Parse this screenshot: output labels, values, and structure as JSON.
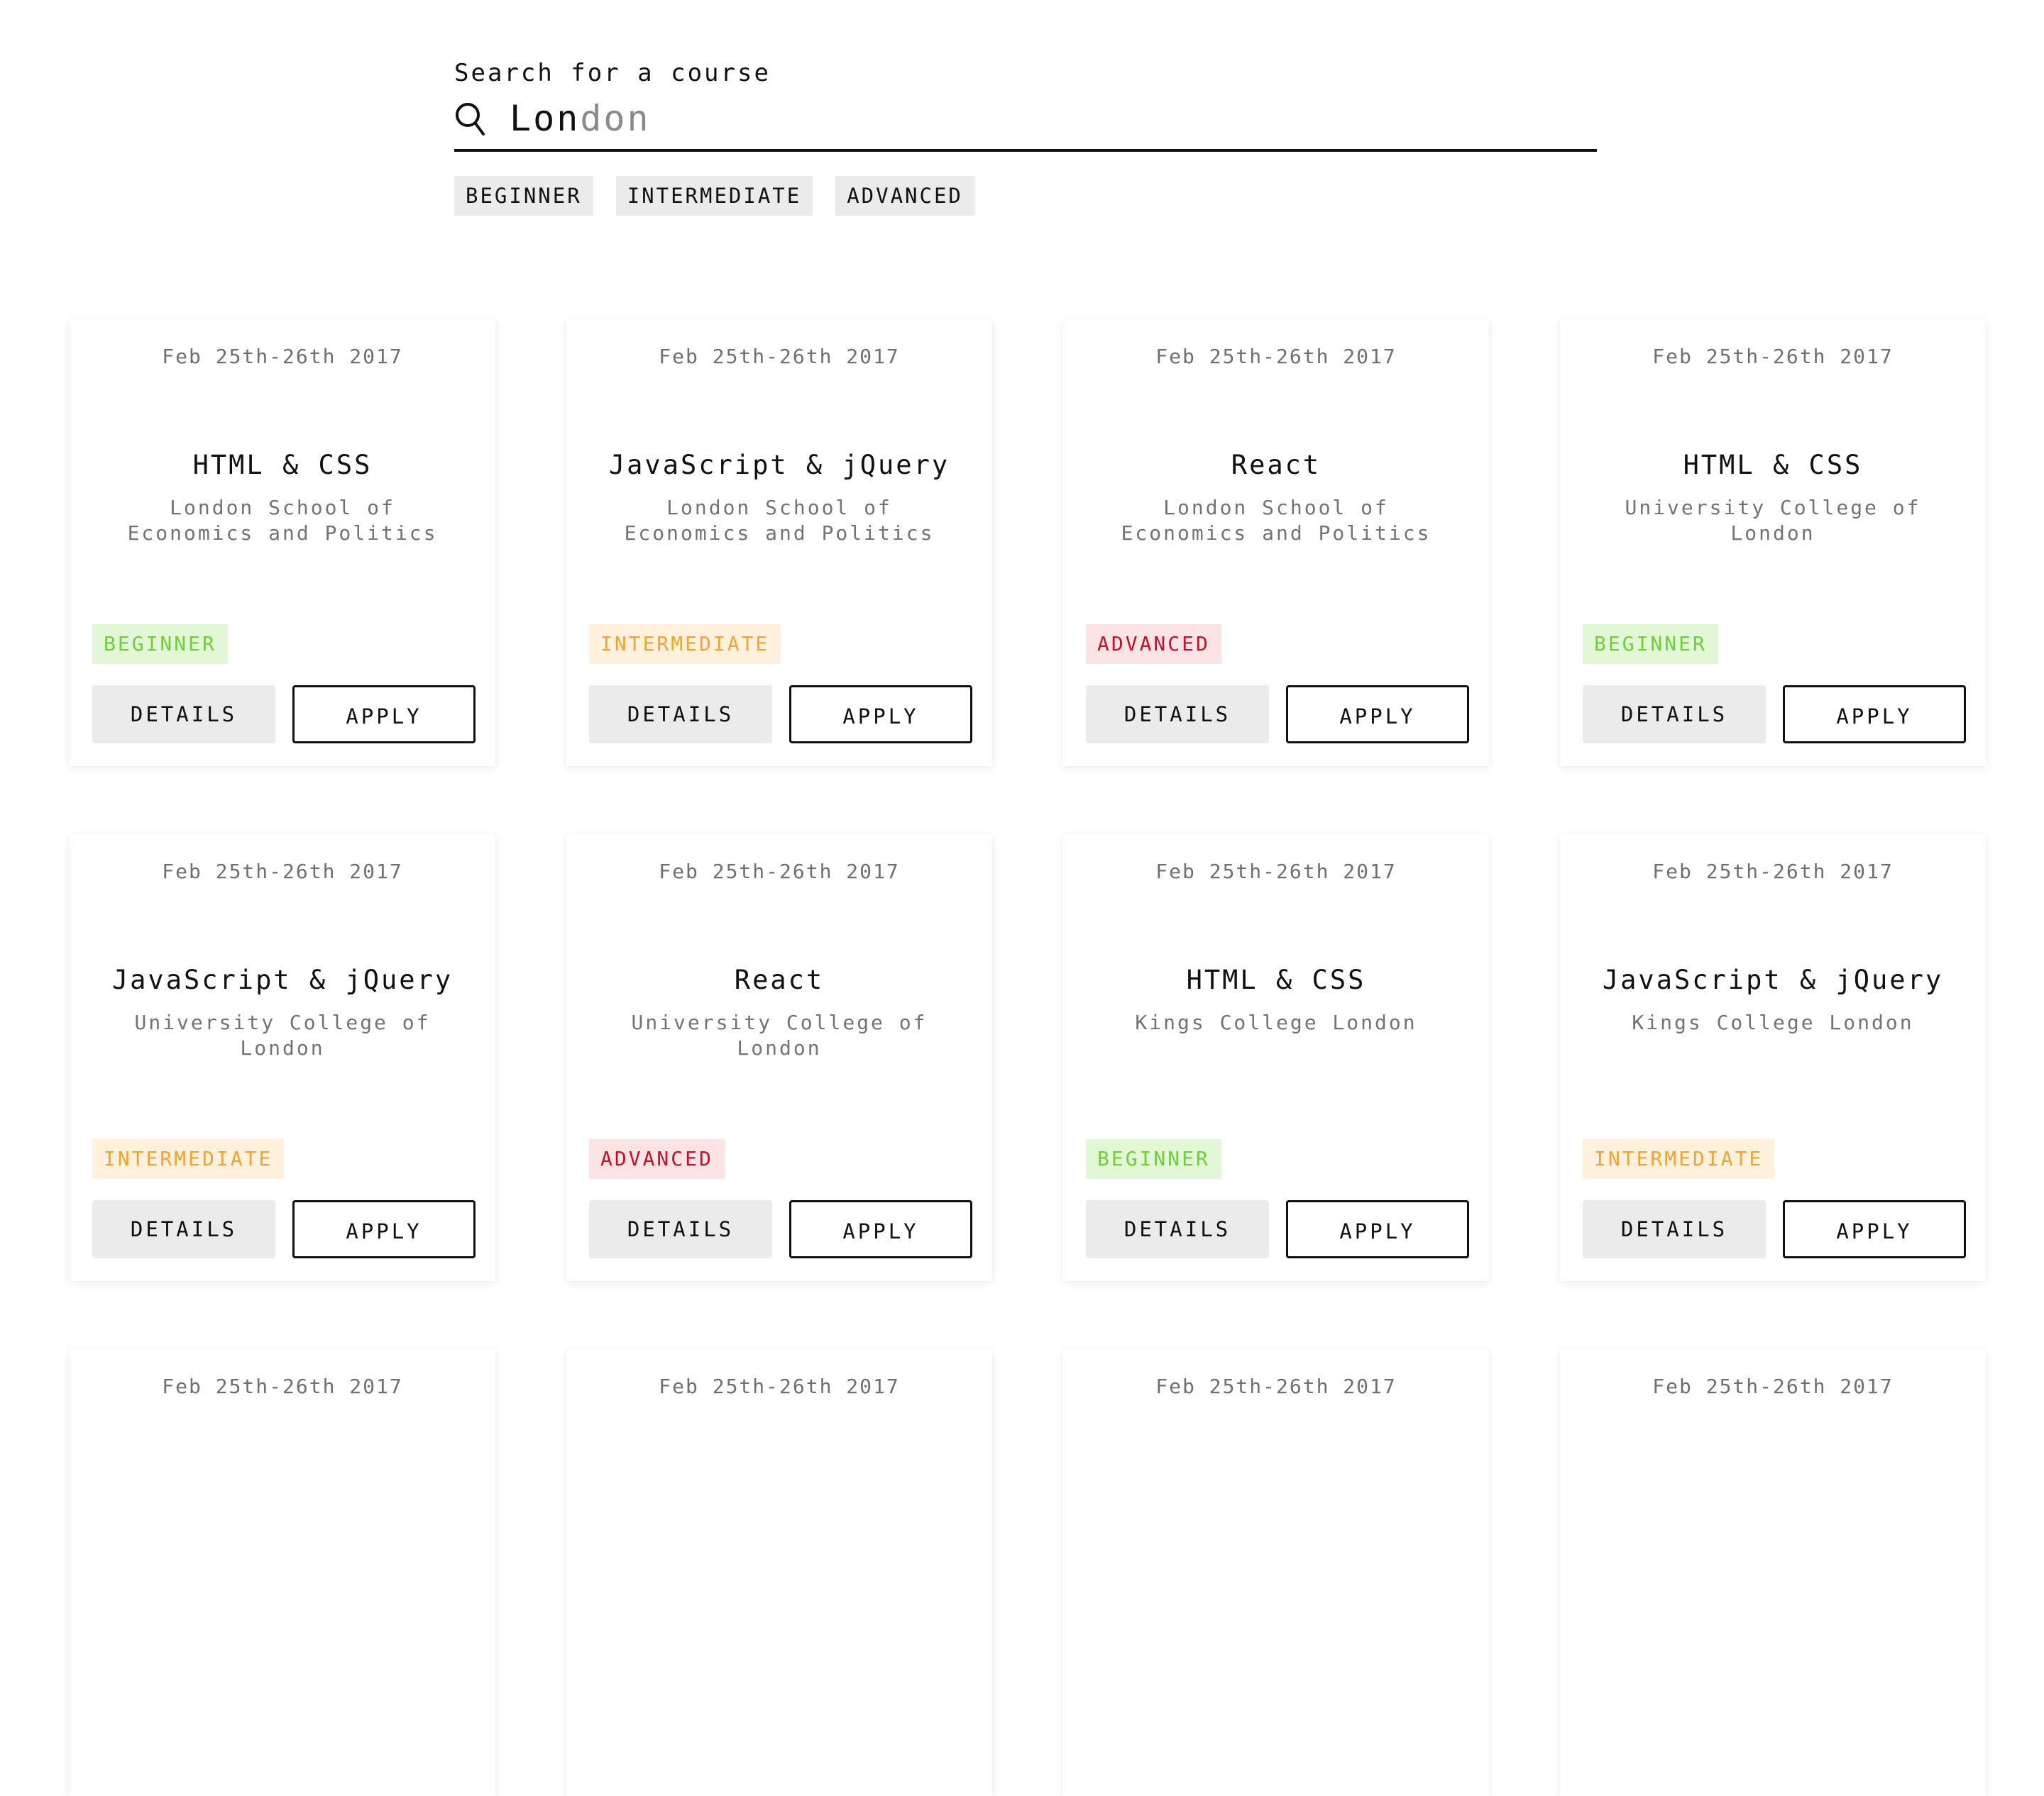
{
  "search": {
    "label": "Search for a course",
    "typed": "Lon",
    "suggestion": "don"
  },
  "filters": [
    "BEGINNER",
    "INTERMEDIATE",
    "ADVANCED"
  ],
  "buttons": {
    "details": "DETAILS",
    "apply": "APPLY"
  },
  "level_colors": {
    "beginner": {
      "bg": "#e2f7d6",
      "fg": "#6fcf36"
    },
    "intermediate": {
      "bg": "#fff1dc",
      "fg": "#f0a431"
    },
    "advanced": {
      "bg": "#fce4e4",
      "fg": "#c4102a"
    }
  },
  "courses": [
    {
      "date": "Feb 25th-26th 2017",
      "title": "HTML & CSS",
      "school": "London School of Economics and Politics",
      "level": "BEGINNER"
    },
    {
      "date": "Feb 25th-26th 2017",
      "title": "JavaScript & jQuery",
      "school": "London School of Economics and Politics",
      "level": "INTERMEDIATE"
    },
    {
      "date": "Feb 25th-26th 2017",
      "title": "React",
      "school": "London School of Economics and Politics",
      "level": "ADVANCED"
    },
    {
      "date": "Feb 25th-26th 2017",
      "title": "HTML & CSS",
      "school": "University College of London",
      "level": "BEGINNER"
    },
    {
      "date": "Feb 25th-26th 2017",
      "title": "JavaScript & jQuery",
      "school": "University College of London",
      "level": "INTERMEDIATE"
    },
    {
      "date": "Feb 25th-26th 2017",
      "title": "React",
      "school": "University College of London",
      "level": "ADVANCED"
    },
    {
      "date": "Feb 25th-26th 2017",
      "title": "HTML & CSS",
      "school": "Kings College London",
      "level": "BEGINNER"
    },
    {
      "date": "Feb 25th-26th 2017",
      "title": "JavaScript & jQuery",
      "school": "Kings College London",
      "level": "INTERMEDIATE"
    },
    {
      "date": "Feb 25th-26th 2017",
      "title": "",
      "school": "",
      "level": ""
    },
    {
      "date": "Feb 25th-26th 2017",
      "title": "",
      "school": "",
      "level": ""
    },
    {
      "date": "Feb 25th-26th 2017",
      "title": "",
      "school": "",
      "level": ""
    },
    {
      "date": "Feb 25th-26th 2017",
      "title": "",
      "school": "",
      "level": ""
    }
  ]
}
